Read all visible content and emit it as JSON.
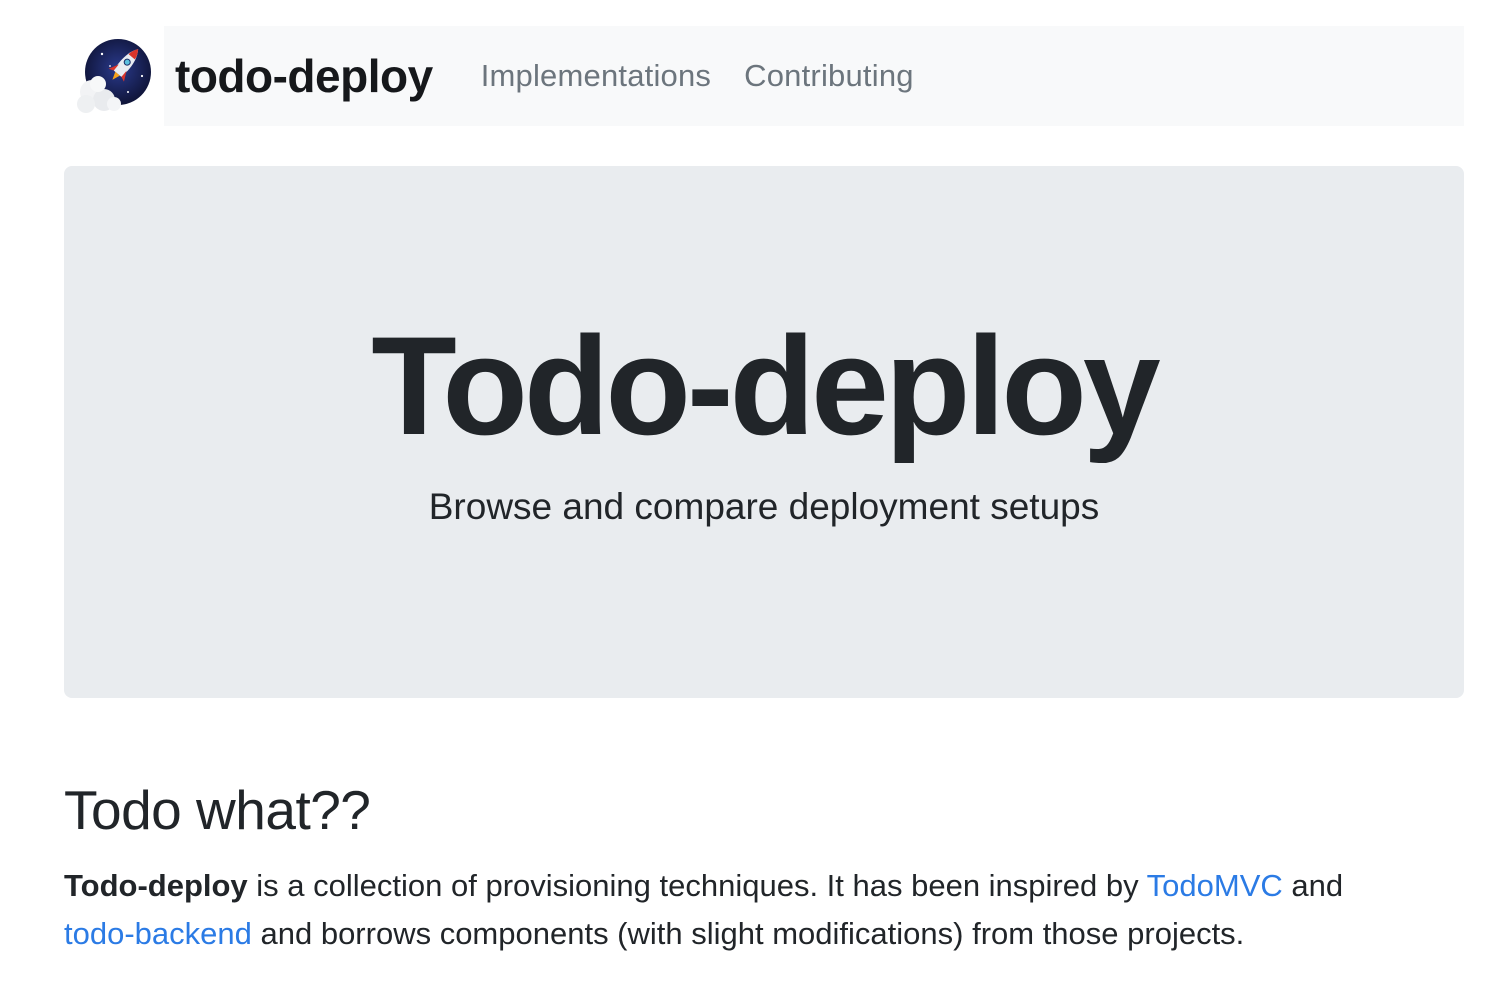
{
  "navbar": {
    "brand": "todo-deploy",
    "links": [
      "Implementations",
      "Contributing"
    ]
  },
  "hero": {
    "title": "Todo-deploy",
    "subtitle": "Browse and compare deployment setups"
  },
  "section": {
    "title": "Todo what??",
    "paragraph": {
      "strong": "Todo-deploy",
      "text1": " is a collection of provisioning techniques. It has been inspired by ",
      "link1": "TodoMVC",
      "text2": " and ",
      "link2": "todo-backend",
      "text3": " and borrows components (with slight modifications) from those projects."
    }
  },
  "colors": {
    "link": "#2b7be5",
    "navbar_bg": "#f8f9fa",
    "jumbotron_bg": "#e9ecef",
    "text": "#212529",
    "nav_link": "#6c757d"
  },
  "icons": {
    "logo": "rocket-launch-logo-icon"
  }
}
